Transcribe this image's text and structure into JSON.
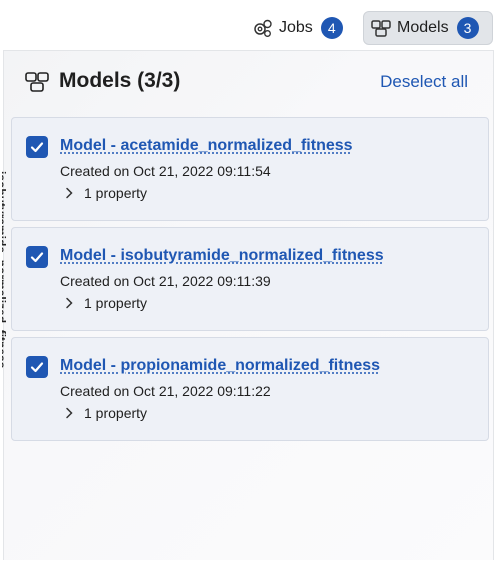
{
  "tabs": {
    "jobs": {
      "label": "Jobs",
      "count": "4",
      "icon": "jobs-gears-icon"
    },
    "models": {
      "label": "Models",
      "count": "3",
      "icon": "models-icon"
    }
  },
  "panel": {
    "title": "Models (3/3)",
    "deselect_label": "Deselect all",
    "side_text": "isobutyramide_normalized_fitness"
  },
  "models": [
    {
      "name": "Model - acetamide_normalized_fitness",
      "created": "Created on Oct 21, 2022 09:11:54",
      "property": "1 property",
      "checked": true
    },
    {
      "name": "Model - isobutyramide_normalized_fitness",
      "created": "Created on Oct 21, 2022 09:11:39",
      "property": "1 property",
      "checked": true
    },
    {
      "name": "Model - propionamide_normalized_fitness",
      "created": "Created on Oct 21, 2022 09:11:22",
      "property": "1 property",
      "checked": true
    }
  ],
  "colors": {
    "accent": "#1f57b3",
    "card_bg": "#eef1f7",
    "tab_active_bg": "#e2e5e9"
  }
}
